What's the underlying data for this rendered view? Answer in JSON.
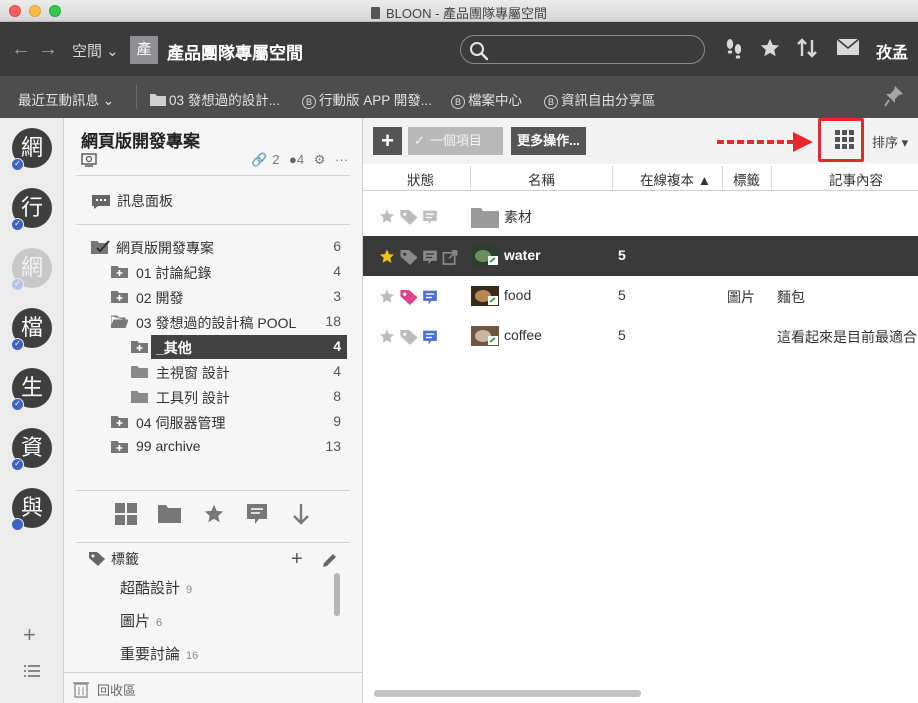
{
  "window": {
    "title": "BLOON - 產品團隊專屬空間"
  },
  "toolbar": {
    "space_label": "空間 ⌄",
    "space_avatar": "產",
    "space_title": "產品團隊專屬空間",
    "user_name": "孜孟",
    "icons": [
      "back-arrow-icon",
      "forward-arrow-icon",
      "search-icon",
      "footprints-icon",
      "star-icon",
      "sort-arrows-icon",
      "mail-icon"
    ]
  },
  "bookmarks": {
    "recent": "最近互動訊息 ⌄",
    "items": [
      {
        "label": "03 發想過的設計...",
        "type": "folder"
      },
      {
        "label": "行動版 APP 開發...",
        "mark": "B"
      },
      {
        "label": "檔案中心",
        "mark": "B"
      },
      {
        "label": "資訊自由分享區",
        "mark": "B"
      }
    ]
  },
  "rail": {
    "avatars": [
      {
        "char": "網",
        "dim": false,
        "badge": "✓"
      },
      {
        "char": "行",
        "dim": false,
        "badge": "✓"
      },
      {
        "char": "網",
        "dim": true,
        "badge": "✓"
      },
      {
        "char": "檔",
        "dim": false,
        "badge": "✓"
      },
      {
        "char": "生",
        "dim": false,
        "badge": "✓"
      },
      {
        "char": "資",
        "dim": false,
        "badge": "✓"
      },
      {
        "char": "與",
        "dim": false,
        "badge": ""
      }
    ],
    "add_label": "+"
  },
  "panel": {
    "project_title": "網頁版開發專案",
    "links_count": "2",
    "members_count": "4",
    "more": "···",
    "message_board": "訊息面板",
    "tree": [
      {
        "label": "網頁版開發專案",
        "count": "6",
        "level": 0,
        "icon": "checked-folder"
      },
      {
        "label": "01 討論紀錄",
        "count": "4",
        "level": 1,
        "icon": "plus-folder"
      },
      {
        "label": "02 開發",
        "count": "3",
        "level": 1,
        "icon": "plus-folder"
      },
      {
        "label": "03 發想過的設計稿 POOL",
        "count": "18",
        "level": 1,
        "icon": "open-folder"
      },
      {
        "label": "_其他",
        "count": "4",
        "level": 2,
        "icon": "plus-folder",
        "selected": true
      },
      {
        "label": "主視窗 設計",
        "count": "4",
        "level": 2,
        "icon": "folder"
      },
      {
        "label": "工具列 設計",
        "count": "8",
        "level": 2,
        "icon": "folder"
      },
      {
        "label": "04 伺服器管理",
        "count": "9",
        "level": 1,
        "icon": "plus-folder"
      },
      {
        "label": "99 archive",
        "count": "13",
        "level": 1,
        "icon": "plus-folder"
      }
    ],
    "tags_heading": "標籤",
    "tags": [
      {
        "label": "超酷設計",
        "count": "9"
      },
      {
        "label": "圖片",
        "count": "6"
      },
      {
        "label": "重要討論",
        "count": "16"
      }
    ],
    "trash": "回收區"
  },
  "content": {
    "add_button": "+",
    "item_button": "一個項目",
    "more_button": "更多操作...",
    "sort_button": "排序 ▾",
    "columns": {
      "state": "狀態",
      "name": "名稱",
      "versions": "在線複本 ▲",
      "tags": "標籤",
      "notes": "記事內容"
    },
    "rows": [
      {
        "name": "素材",
        "versions": "",
        "tags": "",
        "notes": "",
        "kind": "folder",
        "starred": false,
        "tagcolor": "#bdbdbd",
        "notecolor": "#bdbdbd",
        "selected": false
      },
      {
        "name": "water",
        "versions": "5",
        "tags": "",
        "notes": "",
        "kind": "image",
        "starred": true,
        "tagcolor": "#8a8a8a",
        "notecolor": "#8a8a8a",
        "selected": true
      },
      {
        "name": "food",
        "versions": "5",
        "tags": "圖片",
        "notes": "麵包",
        "kind": "image",
        "starred": false,
        "tagcolor": "#e0428c",
        "notecolor": "#4a6fd6",
        "selected": false
      },
      {
        "name": "coffee",
        "versions": "5",
        "tags": "",
        "notes": "這看起來是目前最適合",
        "kind": "image",
        "starred": false,
        "tagcolor": "#bdbdbd",
        "notecolor": "#4a6fd6",
        "selected": false
      }
    ]
  },
  "colors": {
    "accent_annotation": "#e42a2a",
    "badge_blue": "#3f63c5",
    "dark_bar": "#3b3b3b"
  }
}
